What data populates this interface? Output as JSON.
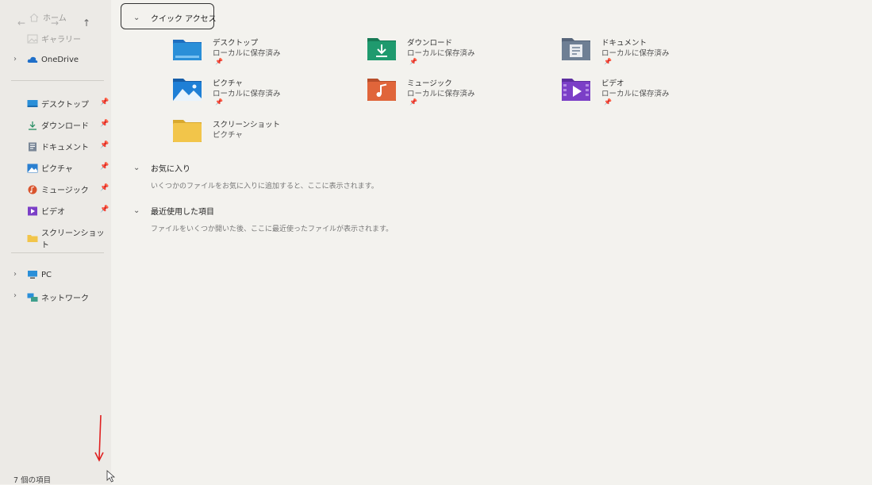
{
  "sidebar": {
    "home_label": "ホーム",
    "gallery_label": "ギャラリー",
    "onedrive_label": "OneDrive",
    "pinned": [
      {
        "label": "デスクトップ",
        "icon": "desktop-icon"
      },
      {
        "label": "ダウンロード",
        "icon": "download-icon"
      },
      {
        "label": "ドキュメント",
        "icon": "document-icon"
      },
      {
        "label": "ピクチャ",
        "icon": "pictures-icon"
      },
      {
        "label": "ミュージック",
        "icon": "music-icon"
      },
      {
        "label": "ビデオ",
        "icon": "video-icon"
      },
      {
        "label": "スクリーンショット",
        "icon": "folder-icon"
      }
    ],
    "pc_label": "PC",
    "network_label": "ネットワーク"
  },
  "main": {
    "quick_access_title": "クイック アクセス",
    "quick_items": [
      {
        "name": "デスクトップ",
        "sub": "ローカルに保存済み",
        "icon": "desktop-folder-icon"
      },
      {
        "name": "ダウンロード",
        "sub": "ローカルに保存済み",
        "icon": "download-folder-icon"
      },
      {
        "name": "ドキュメント",
        "sub": "ローカルに保存済み",
        "icon": "document-folder-icon"
      },
      {
        "name": "ピクチャ",
        "sub": "ローカルに保存済み",
        "icon": "pictures-folder-icon"
      },
      {
        "name": "ミュージック",
        "sub": "ローカルに保存済み",
        "icon": "music-folder-icon"
      },
      {
        "name": "ビデオ",
        "sub": "ローカルに保存済み",
        "icon": "video-folder-icon"
      },
      {
        "name": "スクリーンショット",
        "sub": "ピクチャ",
        "icon": "screenshot-folder-icon"
      }
    ],
    "favorites_title": "お気に入り",
    "favorites_hint": "いくつかのファイルをお気に入りに追加すると、ここに表示されます。",
    "recent_title": "最近使用した項目",
    "recent_hint": "ファイルをいくつか開いた後、ここに最近使ったファイルが表示されます。"
  },
  "status": {
    "item_count": "7 個の項目"
  },
  "colors": {
    "annotation_arrow": "#e02020",
    "desktop_folder": "#1e7fd6",
    "download_folder": "#1f9a6e",
    "document_folder": "#6e7f94",
    "pictures_folder": "#1e7fd6",
    "music_folder": "#e0653a",
    "video_folder": "#7b3fc7",
    "plain_folder": "#f2c54a"
  }
}
